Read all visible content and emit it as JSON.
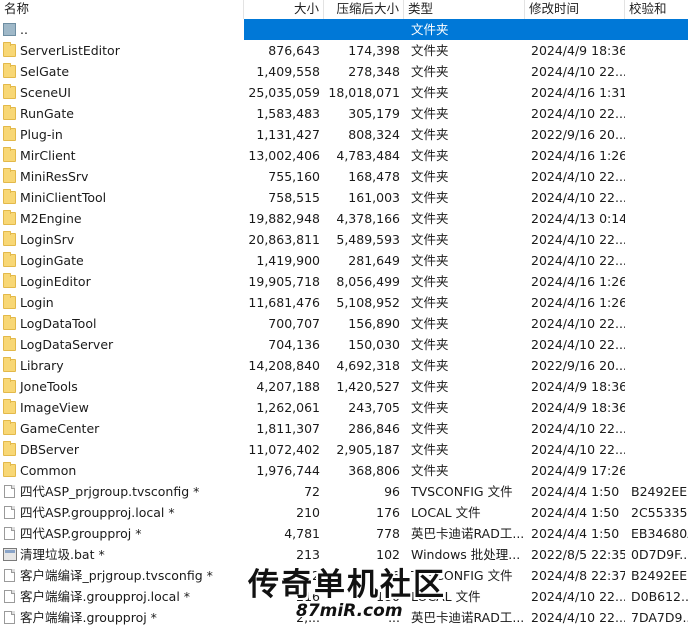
{
  "columns": [
    {
      "key": "name",
      "label": "名称"
    },
    {
      "key": "size",
      "label": "大小"
    },
    {
      "key": "packed",
      "label": "压缩后大小"
    },
    {
      "key": "type",
      "label": "类型"
    },
    {
      "key": "modified",
      "label": "修改时间"
    },
    {
      "key": "crc",
      "label": "校验和"
    }
  ],
  "files": [
    {
      "name": "..",
      "size": "",
      "packed": "",
      "type": "文件夹",
      "modified": "",
      "crc": "",
      "icon": "parent-folder-icon",
      "selected": true
    },
    {
      "name": "ServerListEditor",
      "size": "876,643",
      "packed": "174,398",
      "type": "文件夹",
      "modified": "2024/4/9 18:36",
      "crc": "",
      "icon": "folder-icon"
    },
    {
      "name": "SelGate",
      "size": "1,409,558",
      "packed": "278,348",
      "type": "文件夹",
      "modified": "2024/4/10 22...",
      "crc": "",
      "icon": "folder-icon"
    },
    {
      "name": "SceneUI",
      "size": "25,035,059",
      "packed": "18,018,071",
      "type": "文件夹",
      "modified": "2024/4/16 1:31",
      "crc": "",
      "icon": "folder-icon"
    },
    {
      "name": "RunGate",
      "size": "1,583,483",
      "packed": "305,179",
      "type": "文件夹",
      "modified": "2024/4/10 22...",
      "crc": "",
      "icon": "folder-icon"
    },
    {
      "name": "Plug-in",
      "size": "1,131,427",
      "packed": "808,324",
      "type": "文件夹",
      "modified": "2022/9/16 20...",
      "crc": "",
      "icon": "folder-icon"
    },
    {
      "name": "MirClient",
      "size": "13,002,406",
      "packed": "4,783,484",
      "type": "文件夹",
      "modified": "2024/4/16 1:26",
      "crc": "",
      "icon": "folder-icon"
    },
    {
      "name": "MiniResSrv",
      "size": "755,160",
      "packed": "168,478",
      "type": "文件夹",
      "modified": "2024/4/10 22...",
      "crc": "",
      "icon": "folder-icon"
    },
    {
      "name": "MiniClientTool",
      "size": "758,515",
      "packed": "161,003",
      "type": "文件夹",
      "modified": "2024/4/10 22...",
      "crc": "",
      "icon": "folder-icon"
    },
    {
      "name": "M2Engine",
      "size": "19,882,948",
      "packed": "4,378,166",
      "type": "文件夹",
      "modified": "2024/4/13 0:14",
      "crc": "",
      "icon": "folder-icon"
    },
    {
      "name": "LoginSrv",
      "size": "20,863,811",
      "packed": "5,489,593",
      "type": "文件夹",
      "modified": "2024/4/10 22...",
      "crc": "",
      "icon": "folder-icon"
    },
    {
      "name": "LoginGate",
      "size": "1,419,900",
      "packed": "281,649",
      "type": "文件夹",
      "modified": "2024/4/10 22...",
      "crc": "",
      "icon": "folder-icon"
    },
    {
      "name": "LoginEditor",
      "size": "19,905,718",
      "packed": "8,056,499",
      "type": "文件夹",
      "modified": "2024/4/16 1:26",
      "crc": "",
      "icon": "folder-icon"
    },
    {
      "name": "Login",
      "size": "11,681,476",
      "packed": "5,108,952",
      "type": "文件夹",
      "modified": "2024/4/16 1:26",
      "crc": "",
      "icon": "folder-icon"
    },
    {
      "name": "LogDataTool",
      "size": "700,707",
      "packed": "156,890",
      "type": "文件夹",
      "modified": "2024/4/10 22...",
      "crc": "",
      "icon": "folder-icon"
    },
    {
      "name": "LogDataServer",
      "size": "704,136",
      "packed": "150,030",
      "type": "文件夹",
      "modified": "2024/4/10 22...",
      "crc": "",
      "icon": "folder-icon"
    },
    {
      "name": "Library",
      "size": "14,208,840",
      "packed": "4,692,318",
      "type": "文件夹",
      "modified": "2022/9/16 20...",
      "crc": "",
      "icon": "folder-icon"
    },
    {
      "name": "JoneTools",
      "size": "4,207,188",
      "packed": "1,420,527",
      "type": "文件夹",
      "modified": "2024/4/9 18:36",
      "crc": "",
      "icon": "folder-icon"
    },
    {
      "name": "ImageView",
      "size": "1,262,061",
      "packed": "243,705",
      "type": "文件夹",
      "modified": "2024/4/9 18:36",
      "crc": "",
      "icon": "folder-icon"
    },
    {
      "name": "GameCenter",
      "size": "1,811,307",
      "packed": "286,846",
      "type": "文件夹",
      "modified": "2024/4/10 22...",
      "crc": "",
      "icon": "folder-icon"
    },
    {
      "name": "DBServer",
      "size": "11,072,402",
      "packed": "2,905,187",
      "type": "文件夹",
      "modified": "2024/4/10 22...",
      "crc": "",
      "icon": "folder-icon"
    },
    {
      "name": "Common",
      "size": "1,976,744",
      "packed": "368,806",
      "type": "文件夹",
      "modified": "2024/4/9 17:26",
      "crc": "",
      "icon": "folder-icon"
    },
    {
      "name": "四代ASP_prjgroup.tvsconfig *",
      "size": "72",
      "packed": "96",
      "type": "TVSCONFIG 文件",
      "modified": "2024/4/4 1:50",
      "crc": "B2492EE8",
      "icon": "file-icon"
    },
    {
      "name": "四代ASP.groupproj.local *",
      "size": "210",
      "packed": "176",
      "type": "LOCAL 文件",
      "modified": "2024/4/4 1:50",
      "crc": "2C553352",
      "icon": "file-icon"
    },
    {
      "name": "四代ASP.groupproj *",
      "size": "4,781",
      "packed": "778",
      "type": "英巴卡迪诺RAD工...",
      "modified": "2024/4/4 1:50",
      "crc": "EB34680A",
      "icon": "file-icon"
    },
    {
      "name": "清理垃圾.bat *",
      "size": "213",
      "packed": "102",
      "type": "Windows 批处理...",
      "modified": "2022/8/5 22:35",
      "crc": "0D7D9F...",
      "icon": "batch-file-icon"
    },
    {
      "name": "客户端编译_prjgroup.tvsconfig *",
      "size": "72",
      "packed": "96",
      "type": "TVSCONFIG 文件",
      "modified": "2024/4/8 22:37",
      "crc": "B2492EE8",
      "icon": "file-icon"
    },
    {
      "name": "客户端编译.groupproj.local *",
      "size": "216",
      "packed": "180",
      "type": "LOCAL 文件",
      "modified": "2024/4/10 22...",
      "crc": "D0B612...",
      "icon": "file-icon"
    },
    {
      "name": "客户端编译.groupproj *",
      "size": "2,...",
      "packed": "...",
      "type": "英巴卡迪诺RAD工...",
      "modified": "2024/4/10 22...",
      "crc": "7DA7D9...",
      "icon": "file-icon"
    }
  ],
  "watermark": {
    "main": "传奇单机社区",
    "sub": "87miR.com"
  },
  "colors": {
    "selection": "#0078d7",
    "folder": "#f8d775",
    "sorted_header": "#d9ebf9"
  }
}
